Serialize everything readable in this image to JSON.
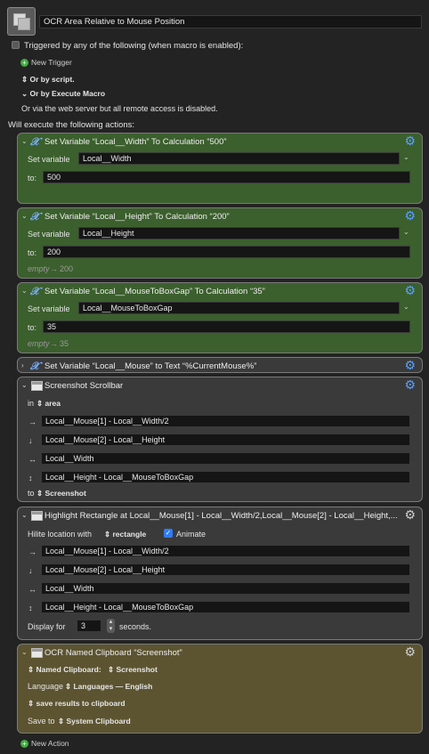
{
  "macro": {
    "name": "OCR Area Relative to Mouse Position"
  },
  "triggers": {
    "header": "Triggered by any of the following (when macro is enabled):",
    "new_trigger": "New Trigger",
    "by_script": "Or by script.",
    "by_execute": "Or by Execute Macro",
    "web_server": "Or via the web server but all remote access is disabled."
  },
  "will_execute": "Will execute the following actions:",
  "actions": [
    {
      "title": "Set Variable “Local__Width” To Calculation “500”",
      "set_label": "Set variable",
      "variable": "Local__Width",
      "to_label": "to:",
      "to_value": "500",
      "result": ""
    },
    {
      "title": "Set Variable “Local__Height” To Calculation “200”",
      "set_label": "Set variable",
      "variable": "Local__Height",
      "to_label": "to:",
      "to_value": "200",
      "empty_label": "empty",
      "result": "200"
    },
    {
      "title": "Set Variable “Local__MouseToBoxGap” To Calculation “35”",
      "set_label": "Set variable",
      "variable": "Local__MouseToBoxGap",
      "to_label": "to:",
      "to_value": "35",
      "empty_label": "empty",
      "result": "35"
    },
    {
      "title": "Set Variable “Local__Mouse” to Text “%CurrentMouse%”"
    },
    {
      "title": "Screenshot Scrollbar",
      "in_label": "in",
      "area": "area",
      "fields": [
        "Local__Mouse[1] - Local__Width/2",
        "Local__Mouse[2] - Local__Height",
        "Local__Width",
        "Local__Height - Local__MouseToBoxGap"
      ],
      "to_label": "to",
      "to_value": "Screenshot"
    },
    {
      "title": "Highlight Rectangle at Local__Mouse[1] - Local__Width/2,Local__Mouse[2] - Local__Height,...",
      "hilite_label": "Hilite location with",
      "shape": "rectangle",
      "animate": "Animate",
      "fields": [
        "Local__Mouse[1] - Local__Width/2",
        "Local__Mouse[2] - Local__Height",
        "Local__Width",
        "Local__Height - Local__MouseToBoxGap"
      ],
      "display_label": "Display for",
      "display_value": "3",
      "seconds": "seconds."
    },
    {
      "title": "OCR Named Clipboard “Screenshot”",
      "clipboard_label": "Named Clipboard:",
      "clipboard_value": "Screenshot",
      "language_label": "Language",
      "language_value": "Languages — English",
      "save_option": "save results to clipboard",
      "save_to_label": "Save to",
      "save_to_value": "System Clipboard"
    }
  ],
  "new_action": "New Action"
}
